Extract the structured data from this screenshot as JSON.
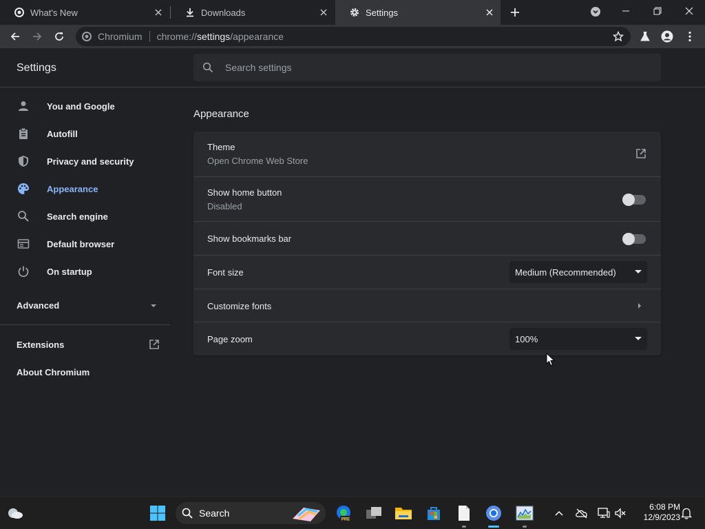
{
  "tabs": [
    {
      "title": "What's New",
      "icon": "chromium-icon"
    },
    {
      "title": "Downloads",
      "icon": "download-icon"
    },
    {
      "title": "Settings",
      "icon": "gear-icon",
      "active": true
    }
  ],
  "omnibox": {
    "site_name": "Chromium",
    "url_scheme": "chrome://",
    "url_host": "settings",
    "url_path": "/appearance"
  },
  "header": {
    "title": "Settings",
    "search_placeholder": "Search settings"
  },
  "sidebar": {
    "items": [
      {
        "label": "You and Google",
        "icon": "person-icon"
      },
      {
        "label": "Autofill",
        "icon": "clipboard-icon"
      },
      {
        "label": "Privacy and security",
        "icon": "shield-icon"
      },
      {
        "label": "Appearance",
        "icon": "palette-icon",
        "active": true
      },
      {
        "label": "Search engine",
        "icon": "search-icon"
      },
      {
        "label": "Default browser",
        "icon": "browser-icon"
      },
      {
        "label": "On startup",
        "icon": "power-icon"
      }
    ],
    "advanced_label": "Advanced",
    "extensions_label": "Extensions",
    "about_label": "About Chromium"
  },
  "main": {
    "section_title": "Appearance",
    "theme": {
      "label": "Theme",
      "sub": "Open Chrome Web Store"
    },
    "home_button": {
      "label": "Show home button",
      "sub": "Disabled",
      "enabled": false
    },
    "bookmarks_bar": {
      "label": "Show bookmarks bar",
      "enabled": false
    },
    "font_size": {
      "label": "Font size",
      "value": "Medium (Recommended)"
    },
    "customize_fonts": {
      "label": "Customize fonts"
    },
    "page_zoom": {
      "label": "Page zoom",
      "value": "100%"
    }
  },
  "taskbar": {
    "search_label": "Search",
    "time": "6:08 PM",
    "date": "12/9/2023",
    "accent": "#4cc2ff"
  },
  "colors": {
    "accent": "#8ab4f8",
    "background": "#202124",
    "card": "#292a2d"
  }
}
